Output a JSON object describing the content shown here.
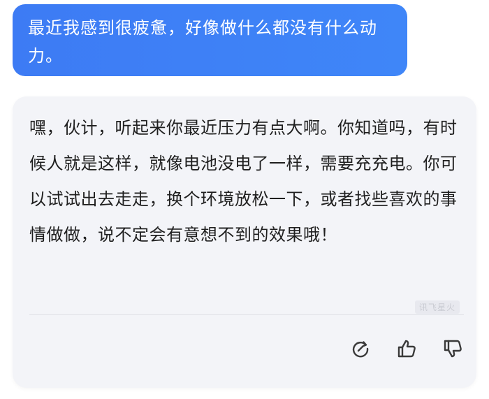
{
  "user_message": {
    "text": "最近我感到很疲惫，好像做什么都没有什么动力。"
  },
  "assistant_message": {
    "text": "嘿，伙计，听起来你最近压力有点大啊。你知道吗，有时候人就是这样，就像电池没电了一样，需要充充电。你可以试试出去走走，换个环境放松一下，或者找些喜欢的事情做做，说不定会有意想不到的效果哦！",
    "watermark": "讯飞星火"
  },
  "actions": [
    {
      "name": "regenerate",
      "icon": "refresh-icon"
    },
    {
      "name": "like",
      "icon": "thumbs-up-icon"
    },
    {
      "name": "dislike",
      "icon": "thumbs-down-icon"
    }
  ],
  "colors": {
    "user_bubble": "#3d7bf4",
    "assistant_bg": "#f3f4f8",
    "text": "#1f1f1f"
  }
}
